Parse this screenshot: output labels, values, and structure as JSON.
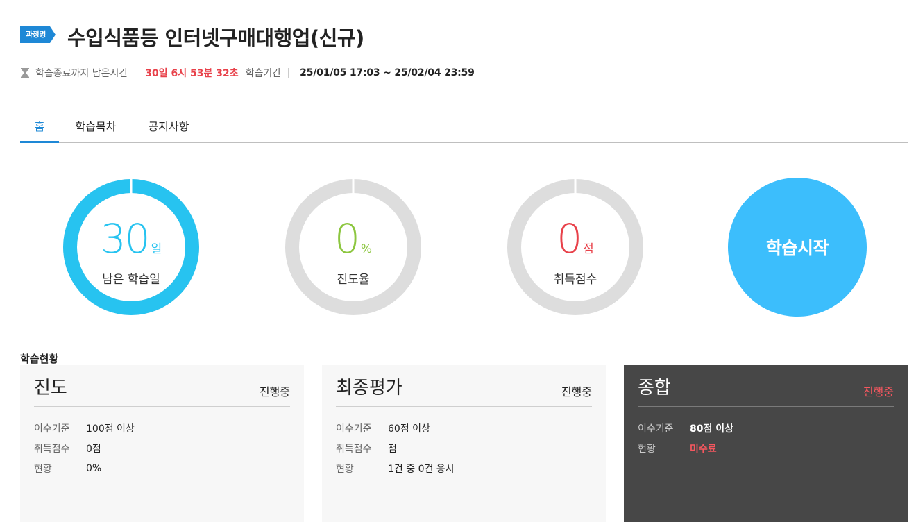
{
  "course": {
    "badge": "과정명",
    "title": "수입식품등 인터넷구매대행업(신규)"
  },
  "meta": {
    "remain_label": "학습종료까지 남은시간",
    "remain_value": "30일 6시 53분 32초",
    "period_label": "학습기간",
    "period_value": "25/01/05 17:03 ~ 25/02/04 23:59"
  },
  "tabs": [
    {
      "label": "홈"
    },
    {
      "label": "학습목차"
    },
    {
      "label": "공지사항"
    }
  ],
  "stats": {
    "days": {
      "value": "30",
      "unit": "일",
      "caption": "남은 학습일",
      "color": "#27c3f0",
      "fraction": 1.0
    },
    "progress": {
      "value": "0",
      "unit": "%",
      "caption": "진도율",
      "color": "#8cc63f",
      "fraction": 0.0
    },
    "score": {
      "value": "0",
      "unit": "점",
      "caption": "취득점수",
      "color": "#e8414a",
      "fraction": 0.0
    }
  },
  "start_button": {
    "label": "학습시작"
  },
  "status_section": {
    "title": "학습현황"
  },
  "cards": [
    {
      "name": "진도",
      "status": "진행중",
      "rows": [
        {
          "key": "이수기준",
          "value": "100점 이상"
        },
        {
          "key": "취득점수",
          "value": "0점"
        },
        {
          "key": "현황",
          "value": "0%"
        }
      ]
    },
    {
      "name": "최종평가",
      "status": "진행중",
      "rows": [
        {
          "key": "이수기준",
          "value": "60점 이상"
        },
        {
          "key": "취득점수",
          "value": "점"
        },
        {
          "key": "현황",
          "value": "1건 중 0건 응시"
        }
      ]
    },
    {
      "name": "종합",
      "status": "진행중",
      "rows": [
        {
          "key": "이수기준",
          "value": "80점 이상"
        },
        {
          "key": "현황",
          "value": "미수료"
        }
      ]
    }
  ],
  "colors": {
    "accent": "#1e88d6",
    "start": "#3cbefc",
    "ring_track": "#dddddd",
    "alert": "#e8414a"
  }
}
